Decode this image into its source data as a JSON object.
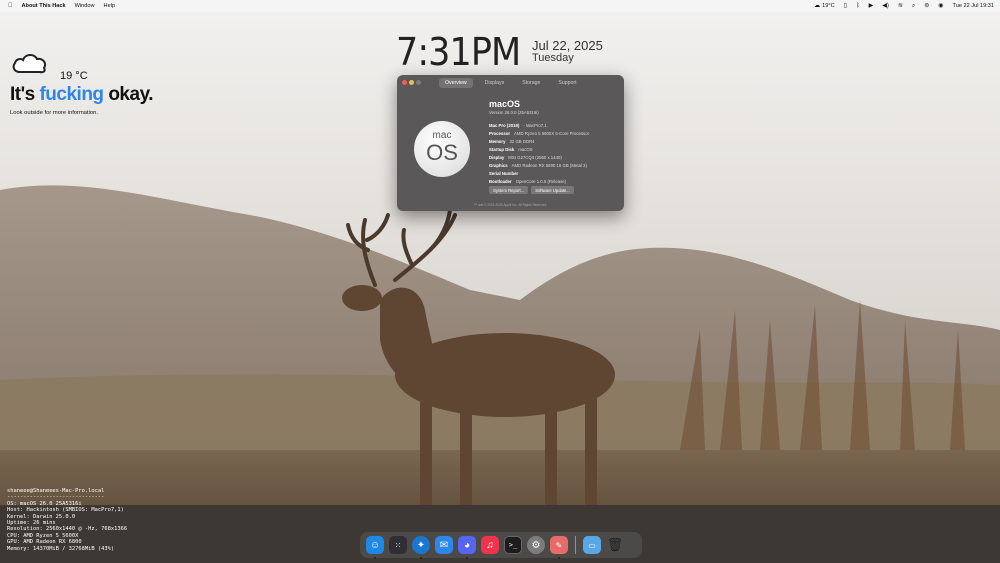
{
  "menubar": {
    "apple_icon": "apple-icon",
    "app": "About This Hack",
    "menus": [
      "Window",
      "Help"
    ],
    "weather": "19°C",
    "datetime": "Tue 22 Jul 19:31"
  },
  "clock": {
    "time": "7:31PM",
    "date": "Jul 22, 2025",
    "day": "Tuesday"
  },
  "weather": {
    "icon": "cloud-icon",
    "temperature": "19 °C",
    "headline_a": "It's ",
    "headline_b": "fucking",
    "headline_c": " okay.",
    "accent_color": "#2f86e6",
    "subtext": "Look outside for more information."
  },
  "about": {
    "tabs": [
      "Overview",
      "Displays",
      "Storage",
      "Support"
    ],
    "active_tab": "Overview",
    "logo_line1": "mac",
    "logo_line2": "OS",
    "os_name": "macOS",
    "version": "Version 26.0.0 (25A5316i)",
    "rows": [
      {
        "k": "Mac Pro (2019)",
        "v": "- MacPro7,1"
      },
      {
        "k": "Processor",
        "v": "AMD Ryzen 5 5600X 6-Core Processor"
      },
      {
        "k": "Memory",
        "v": "32 GB  DDR4"
      },
      {
        "k": "Startup Disk",
        "v": "macOS"
      },
      {
        "k": "Display",
        "v": "MSI G27CQ4 (2560 x 1440)"
      },
      {
        "k": "Graphics",
        "v": "AMD Radeon RX 6800 16 GB (Metal 3)"
      },
      {
        "k": "Serial Number",
        "v": ""
      },
      {
        "k": "Bootloader",
        "v": "OpenCore 1.0.5 (Release)"
      }
    ],
    "button_report": "System Report...",
    "button_update": "Software Update...",
    "copyright": "™ and © 2001-2025 Apple Inc. All Rights Reserved."
  },
  "neofetch": {
    "user": "shaneee@Shaneees-Mac-Pro.local",
    "separator": "------------------------------",
    "lines": [
      "OS: macOS 26.0 25A5316i",
      "Host: Hackintosh (SMBIOS: MacPro7,1)",
      "Kernel: Darwin 25.0.0",
      "Uptime: 26 mins",
      "Resolution: 2560x1440 @ -Hz, 768x1366",
      "CPU: AMD Ryzen 5 5600X",
      "GPU: AMD Radeon RX 6800",
      "Memory: 14370MiB / 32768MiB (43%)"
    ]
  },
  "dock": {
    "apps": [
      {
        "name": "finder",
        "color": "#1e88e5",
        "running": true
      },
      {
        "name": "launchpad",
        "color": "#2e2e34",
        "running": false
      },
      {
        "name": "safari",
        "color": "#1976d2",
        "running": true
      },
      {
        "name": "mail",
        "color": "#2d86e8",
        "running": false
      },
      {
        "name": "discord",
        "color": "#5865f2",
        "running": true
      },
      {
        "name": "music",
        "color": "#f0334d",
        "running": false
      },
      {
        "name": "terminal",
        "color": "#1d1d1d",
        "running": false
      },
      {
        "name": "system-settings",
        "color": "#7c7c7c",
        "running": false
      },
      {
        "name": "about-this-hack",
        "color": "#e86b6b",
        "running": true
      }
    ],
    "folder_color": "#5aa7e6",
    "trash_color": "#3a3a3a"
  }
}
